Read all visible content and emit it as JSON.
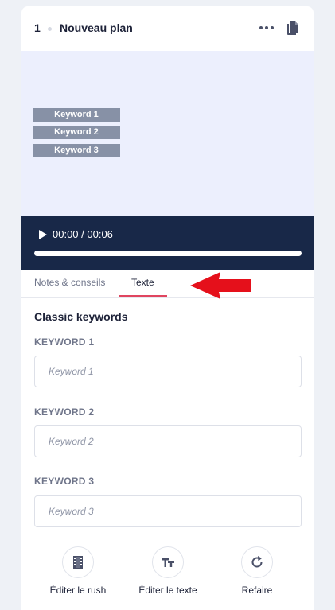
{
  "header": {
    "plan_number": "1",
    "plan_title": "Nouveau plan"
  },
  "preview": {
    "keywords": [
      "Keyword 1",
      "Keyword 2",
      "Keyword 3"
    ]
  },
  "player": {
    "time": "00:00 / 00:06",
    "progress": 0
  },
  "tabs": [
    {
      "label": "Notes & conseils",
      "active": false
    },
    {
      "label": "Texte",
      "active": true
    }
  ],
  "form": {
    "section_title": "Classic keywords",
    "fields": [
      {
        "label": "KEYWORD 1",
        "placeholder": "Keyword 1"
      },
      {
        "label": "KEYWORD 2",
        "placeholder": "Keyword 2"
      },
      {
        "label": "KEYWORD 3",
        "placeholder": "Keyword 3"
      }
    ]
  },
  "actions": [
    {
      "label": "Éditer le rush",
      "icon": "film-icon"
    },
    {
      "label": "Éditer le texte",
      "icon": "text-size-icon"
    },
    {
      "label": "Refaire",
      "icon": "redo-icon"
    }
  ],
  "colors": {
    "accent": "#e0455f",
    "player_bg": "#182848",
    "preview_bg": "#eceffd",
    "keyword_box": "#8791a6",
    "arrow": "#e5101b"
  }
}
